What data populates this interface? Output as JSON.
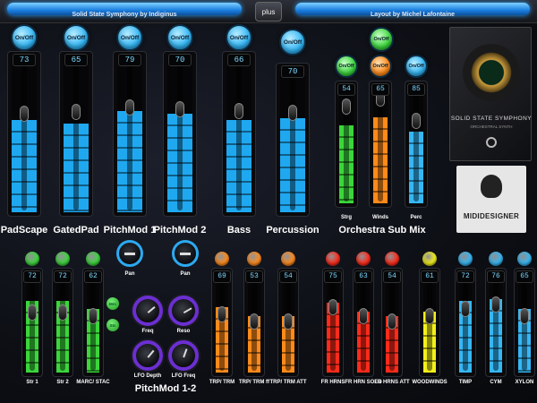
{
  "header": {
    "left_title": "Solid State Symphony by Indiginus",
    "right_title": "Layout by Michel Lafontaine",
    "plus_label": "plus"
  },
  "top_channels": [
    {
      "name": "PadScape",
      "value": "73",
      "button": "On/Off"
    },
    {
      "name": "GatedPad",
      "value": "65",
      "button": "On/Off"
    },
    {
      "name": "PitchMod 1",
      "value": "79",
      "button": "On/Off"
    },
    {
      "name": "PitchMod 2",
      "value": "70",
      "button": "On/Off"
    },
    {
      "name": "Bass",
      "value": "66",
      "button": "On/Off"
    },
    {
      "name": "Percussion",
      "value": "70",
      "button": "On/Off"
    }
  ],
  "orchestra_sub_mix": {
    "title": "Orchestra Sub Mix",
    "channels": [
      {
        "name": "Strg",
        "value": "54",
        "button": "On/Off",
        "color": "#3bd63b"
      },
      {
        "name": "Winds",
        "value": "65",
        "button": "On/Off",
        "color": "#ff8a1a"
      },
      {
        "name": "Perc",
        "value": "85",
        "button": "On/Off",
        "color": "#35b7f5"
      }
    ],
    "extra_button": "On/Off"
  },
  "pan_knobs": [
    {
      "label": "Pan"
    },
    {
      "label": "Pan"
    }
  ],
  "pitchmod_section": {
    "title": "PitchMod 1-2",
    "knobs": [
      {
        "label": "Freq"
      },
      {
        "label": "Reso"
      },
      {
        "label": "LFO Depth"
      },
      {
        "label": "LFO Freq"
      }
    ]
  },
  "side_buttons": [
    {
      "label": "Mrc"
    },
    {
      "label": "Stc"
    }
  ],
  "bottom_channels": [
    {
      "name": "Str 1",
      "value": "72",
      "color": "#3bd63b"
    },
    {
      "name": "Str 2",
      "value": "72",
      "color": "#3bd63b"
    },
    {
      "name": "MARC/ STAC",
      "value": "62",
      "color": "#3bd63b"
    },
    {
      "name": "TRP/ TRM",
      "value": "69",
      "color": "#ff8a1a"
    },
    {
      "name": "TRP/ TRM ff",
      "value": "53",
      "color": "#ff8a1a"
    },
    {
      "name": "TRP/ TRM ATT",
      "value": "54",
      "color": "#ff8a1a"
    },
    {
      "name": "FR HRNS",
      "value": "75",
      "color": "#ff2b1a"
    },
    {
      "name": "FR HRN SOLO",
      "value": "63",
      "color": "#ff2b1a"
    },
    {
      "name": "FR HRNS ATT",
      "value": "54",
      "color": "#ff2b1a"
    },
    {
      "name": "WOODWINDS",
      "value": "61",
      "color": "#f3f01a"
    },
    {
      "name": "TIMP",
      "value": "72",
      "color": "#35b7f5"
    },
    {
      "name": "CYM",
      "value": "76",
      "color": "#35b7f5"
    },
    {
      "name": "XYLON",
      "value": "65",
      "color": "#35b7f5"
    }
  ],
  "product_box": {
    "title": "SOLID STATE SYMPHONY",
    "subtitle": "ORCHESTRAL SYNTH"
  },
  "logo": {
    "text": "MIDIDESIGNER"
  }
}
